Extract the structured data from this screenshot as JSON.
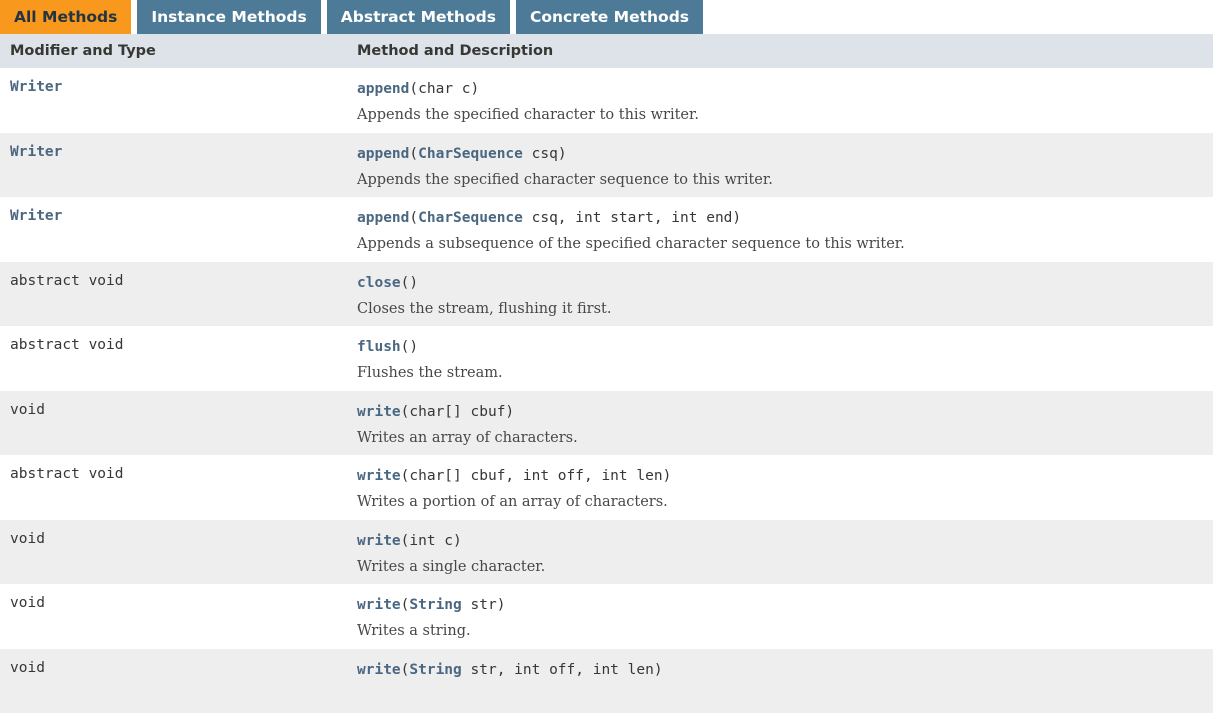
{
  "tabs": [
    {
      "label": "All Methods",
      "active": true
    },
    {
      "label": "Instance Methods",
      "active": false
    },
    {
      "label": "Abstract Methods",
      "active": false
    },
    {
      "label": "Concrete Methods",
      "active": false
    }
  ],
  "table": {
    "headers": {
      "modifier": "Modifier and Type",
      "method": "Method and Description"
    },
    "rows": [
      {
        "type": "Writer",
        "type_link": true,
        "name": "append",
        "params": [
          {
            "t": "char c"
          }
        ],
        "desc": "Appends the specified character to this writer."
      },
      {
        "type": "Writer",
        "type_link": true,
        "name": "append",
        "params": [
          {
            "t": "CharSequence",
            "link": true
          },
          {
            "t": " csq"
          }
        ],
        "desc": "Appends the specified character sequence to this writer."
      },
      {
        "type": "Writer",
        "type_link": true,
        "name": "append",
        "params": [
          {
            "t": "CharSequence",
            "link": true
          },
          {
            "t": " csq, int start, int end"
          }
        ],
        "desc": "Appends a subsequence of the specified character sequence to this writer."
      },
      {
        "type": "abstract void",
        "type_link": false,
        "name": "close",
        "params": [],
        "desc": "Closes the stream, flushing it first."
      },
      {
        "type": "abstract void",
        "type_link": false,
        "name": "flush",
        "params": [],
        "desc": "Flushes the stream."
      },
      {
        "type": "void",
        "type_link": false,
        "name": "write",
        "params": [
          {
            "t": "char[] cbuf"
          }
        ],
        "desc": "Writes an array of characters."
      },
      {
        "type": "abstract void",
        "type_link": false,
        "name": "write",
        "params": [
          {
            "t": "char[] cbuf, int off, int len"
          }
        ],
        "desc": "Writes a portion of an array of characters."
      },
      {
        "type": "void",
        "type_link": false,
        "name": "write",
        "params": [
          {
            "t": "int c"
          }
        ],
        "desc": "Writes a single character."
      },
      {
        "type": "void",
        "type_link": false,
        "name": "write",
        "params": [
          {
            "t": "String",
            "link": true
          },
          {
            "t": " str"
          }
        ],
        "desc": "Writes a string."
      },
      {
        "type": "void",
        "type_link": false,
        "name": "write",
        "params": [
          {
            "t": "String",
            "link": true
          },
          {
            "t": " str, int off, int len"
          }
        ],
        "desc": ""
      }
    ]
  },
  "colors": {
    "tab_active": "#f8981d",
    "tab_inactive": "#4d7a97",
    "header_bg": "#dee3e9",
    "row_alt": "#eeeeef",
    "link": "#4a6782"
  }
}
